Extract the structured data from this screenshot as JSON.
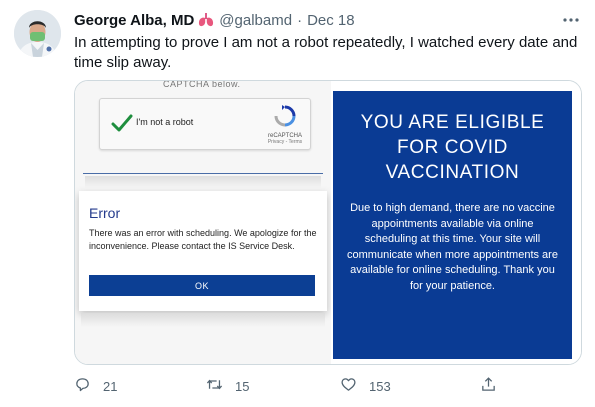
{
  "tweet": {
    "author_name": "George Alba, MD",
    "author_emoji_icon": "lungs-icon",
    "handle": "@galbamd",
    "separator": "·",
    "date": "Dec 18",
    "text": "In attempting to prove I am not a robot repeatedly, I watched every date and time slip away."
  },
  "media": {
    "left": {
      "captcha_header_fragment": "CAPTCHA below.",
      "captcha_label": "I'm not a robot",
      "captcha_brand": "reCAPTCHA",
      "captcha_links": "Privacy - Terms",
      "error_title": "Error",
      "error_message": "There was an error with scheduling. We apologize for the inconvenience. Please contact the IS Service Desk.",
      "ok_label": "OK"
    },
    "right": {
      "title": "YOU ARE ELIGIBLE FOR COVID VACCINATION",
      "body": "Due to high demand, there are no vaccine appointments available via online scheduling at this time. Your site will communicate when more appointments are available for online scheduling. Thank you for your patience."
    }
  },
  "actions": {
    "replies": "21",
    "retweets": "15",
    "likes": "153"
  },
  "colors": {
    "notice_blue": "#0a3b94",
    "ok_button_blue": "#0c3f94",
    "error_title_blue": "#233a8c",
    "retweet_green": "#17bf63",
    "captcha_check_green": "#1e8e3e",
    "meta_gray": "#536471"
  }
}
